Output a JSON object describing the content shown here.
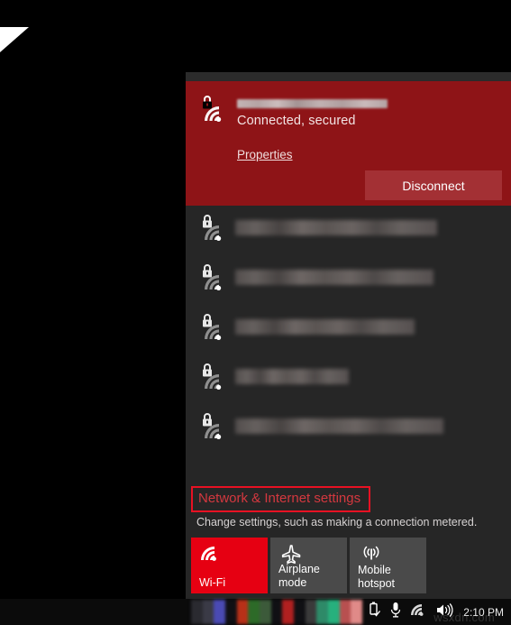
{
  "desktop": {
    "corner_shape": "page-corner-triangle"
  },
  "flyout": {
    "connected": {
      "ssid": "",
      "ssid_redacted": true,
      "status": "Connected, secured",
      "properties_label": "Properties",
      "disconnect_label": "Disconnect",
      "lock_icon": "lock-icon",
      "signal_icon": "wifi-signal-icon",
      "accent_color": "#8e1417",
      "button_color": "#a33034"
    },
    "available_networks": [
      {
        "ssid": "",
        "redacted": true,
        "width_pct": 62,
        "lock_icon": "lock-icon",
        "signal_icon": "wifi-signal-icon"
      },
      {
        "ssid": "",
        "redacted": true,
        "width_pct": 61,
        "lock_icon": "lock-icon",
        "signal_icon": "wifi-signal-icon"
      },
      {
        "ssid": "",
        "redacted": true,
        "width_pct": 55,
        "lock_icon": "lock-icon",
        "signal_icon": "wifi-signal-icon"
      },
      {
        "ssid": "",
        "redacted": true,
        "width_pct": 35,
        "lock_icon": "lock-icon",
        "signal_icon": "wifi-signal-icon"
      },
      {
        "ssid": "",
        "redacted": true,
        "width_pct": 64,
        "lock_icon": "lock-icon",
        "signal_icon": "wifi-signal-icon"
      }
    ],
    "settings": {
      "link_label": "Network & Internet settings",
      "link_color": "#d4383f",
      "highlight_box_color": "#e81123",
      "description": "Change settings, such as making a connection metered."
    },
    "quick_tiles": [
      {
        "label": "Wi-Fi",
        "icon": "wifi-signal-icon",
        "active": true,
        "color": "#e60012"
      },
      {
        "label": "Airplane mode",
        "icon": "airplane-icon",
        "active": false,
        "color": "#4a4a4a"
      },
      {
        "label": "Mobile hotspot",
        "icon": "hotspot-icon",
        "active": false,
        "color": "#4a4a4a"
      }
    ]
  },
  "taskbar": {
    "tray_icons": [
      {
        "name": "usb-eject-icon"
      },
      {
        "name": "microphone-icon"
      },
      {
        "name": "wifi-signal-icon"
      },
      {
        "name": "volume-icon"
      }
    ],
    "clock": "2:10 PM",
    "watermark": "wsxdn.com",
    "pixelated_tray_colors": [
      "#2a2a30",
      "#3a3a46",
      "#4a4ab4",
      "#b83018",
      "#2d6a28",
      "#3c5a3a",
      "#7d1c1c",
      "#b02020",
      "#3a3a3a",
      "#2e8a68",
      "#27b07d",
      "#b85050",
      "#e08a88"
    ]
  }
}
